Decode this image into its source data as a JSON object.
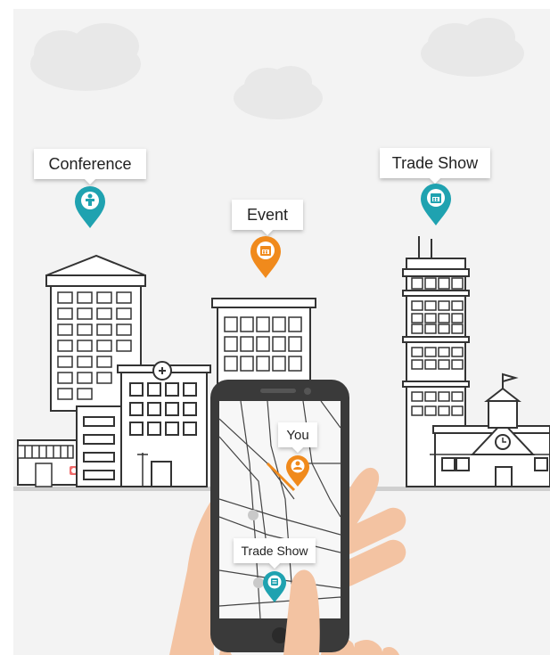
{
  "labels": {
    "conference": "Conference",
    "event": "Event",
    "trade_show": "Trade Show",
    "phone_you": "You",
    "phone_trade_show": "Trade Show"
  },
  "colors": {
    "background": "#f3f3f3",
    "teal_pin": "#1fa2b0",
    "orange_pin": "#f08a1c",
    "building_outline": "#333333",
    "ground": "#cfcfcf",
    "phone_body": "#3a3a3a",
    "skin": "#f3c3a2",
    "cloud": "#e9e9e9"
  },
  "icons": {
    "conference_pin": "presenter-icon",
    "event_pin": "calendar-icon",
    "trade_show_pin": "calendar-icon",
    "you_pin": "person-icon",
    "phone_trade_show_pin": "booth-icon"
  }
}
